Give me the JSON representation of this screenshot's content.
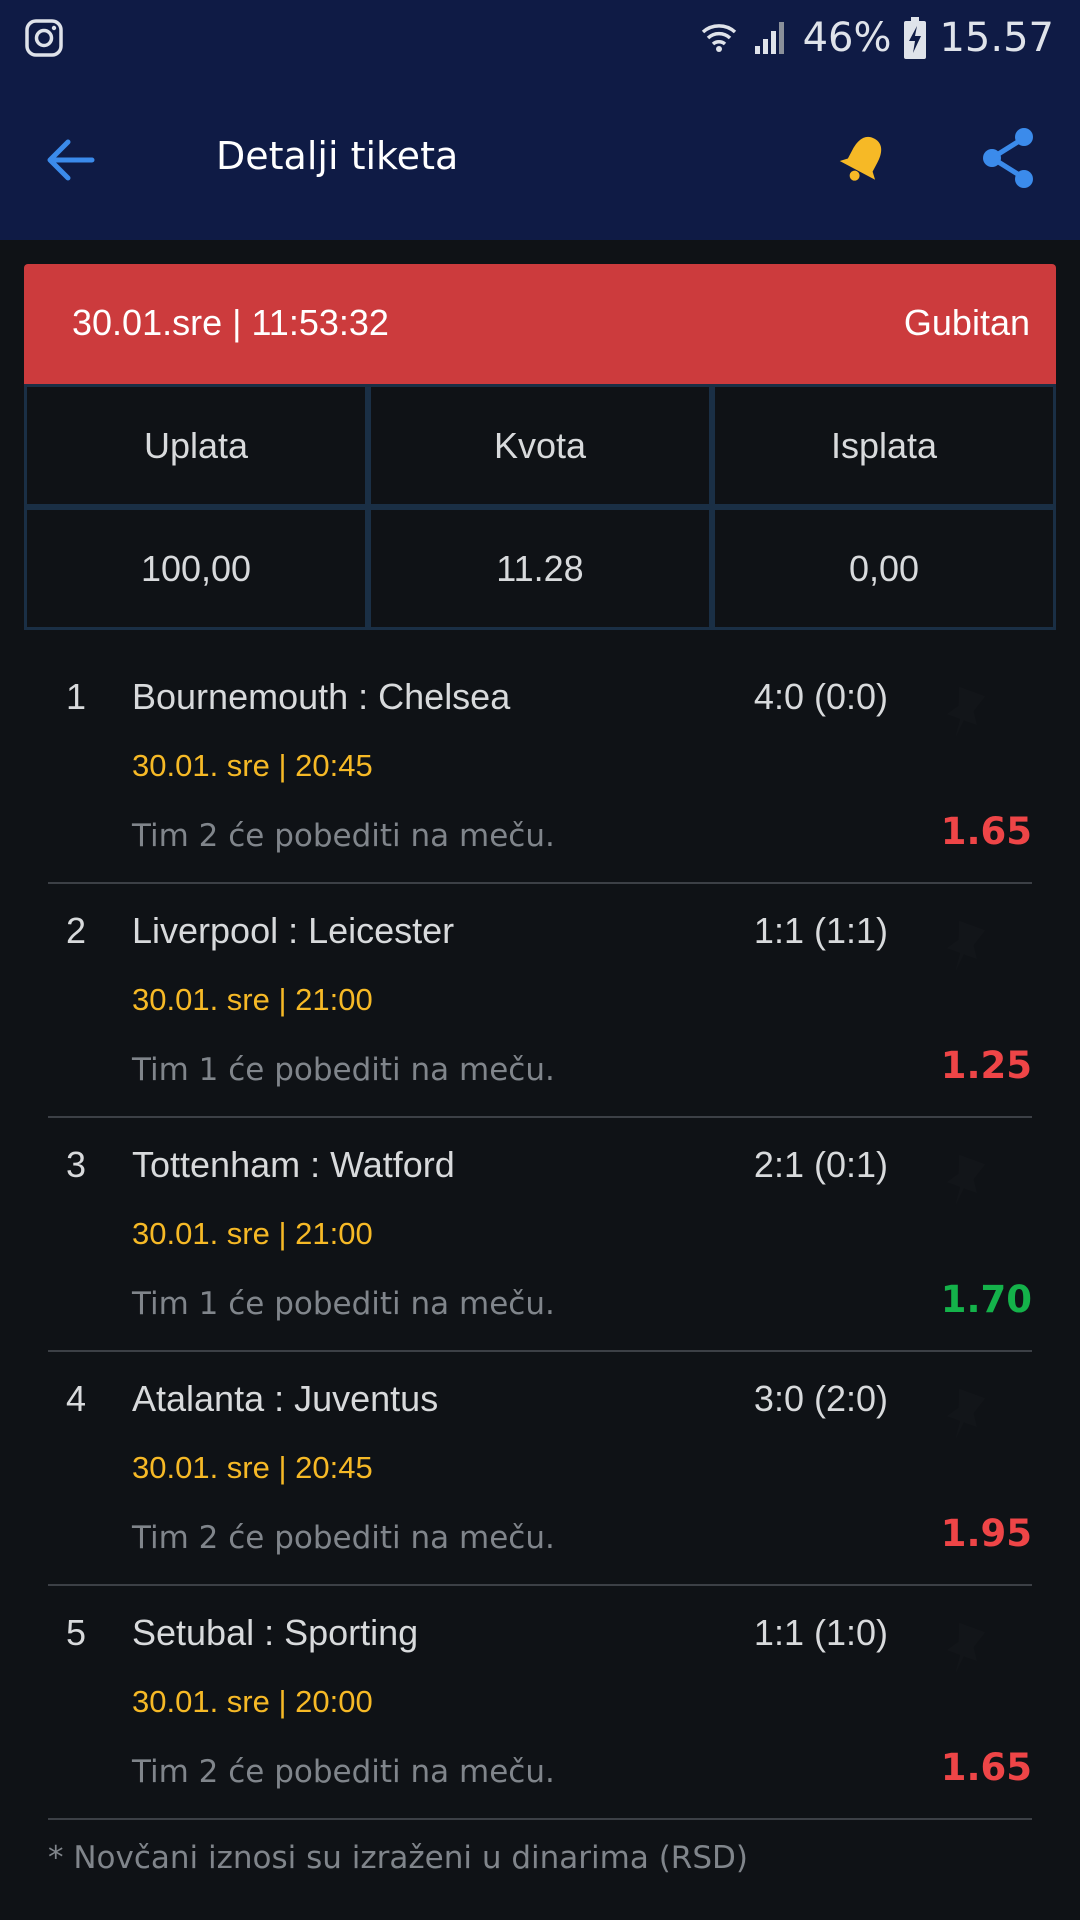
{
  "status_bar": {
    "battery": "46%",
    "time": "15.57"
  },
  "app_bar": {
    "title": "Detalji tiketa"
  },
  "ticket": {
    "datetime": "30.01.sre | 11:53:32",
    "status": "Gubitan",
    "status_color": "#cc3b3d",
    "headers": [
      "Uplata",
      "Kvota",
      "Isplata"
    ],
    "values": [
      "100,00",
      "11.28",
      "0,00"
    ]
  },
  "matches": [
    {
      "num": "1",
      "teams": "Bournemouth : Chelsea",
      "score": "4:0 (0:0)",
      "time": "30.01. sre | 20:45",
      "desc": "Tim 2 će pobediti na meču.",
      "odd": "1.65",
      "color": "#ee4547"
    },
    {
      "num": "2",
      "teams": "Liverpool : Leicester",
      "score": "1:1 (1:1)",
      "time": "30.01. sre | 21:00",
      "desc": "Tim 1 će pobediti na meču.",
      "odd": "1.25",
      "color": "#ee4547"
    },
    {
      "num": "3",
      "teams": "Tottenham : Watford",
      "score": "2:1 (0:1)",
      "time": "30.01. sre | 21:00",
      "desc": "Tim 1 će pobediti na meču.",
      "odd": "1.70",
      "color": "#14b24a"
    },
    {
      "num": "4",
      "teams": "Atalanta : Juventus",
      "score": "3:0 (2:0)",
      "time": "30.01. sre | 20:45",
      "desc": "Tim 2 će pobediti na meču.",
      "odd": "1.95",
      "color": "#ee4547"
    },
    {
      "num": "5",
      "teams": "Setubal : Sporting",
      "score": "1:1 (1:0)",
      "time": "30.01. sre | 20:00",
      "desc": "Tim 2 će pobediti na meču.",
      "odd": "1.65",
      "color": "#ee4547"
    }
  ],
  "footer_note": "* Novčani iznosi su izraženi u dinarima (RSD)",
  "colors": {
    "app_bar": "#0f1b45",
    "accent_blue": "#3b8beb",
    "bell": "#f6b926",
    "time_text": "#f6b926"
  }
}
